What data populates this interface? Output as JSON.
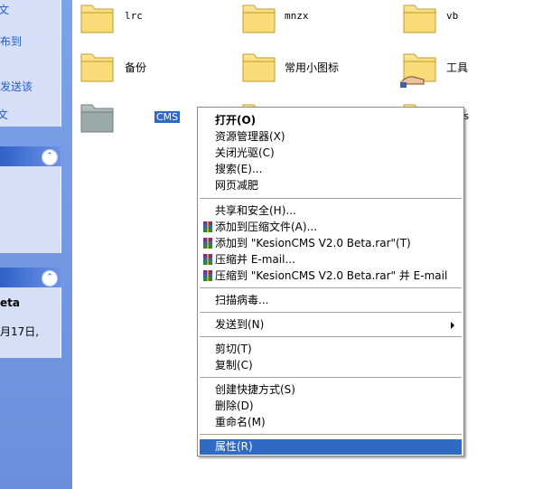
{
  "left_pane": {
    "section1_lines": [
      "布到",
      "发送该"
    ],
    "section2_heading": "",
    "section3_lines": [
      "eta",
      "月17日,"
    ]
  },
  "folders": [
    {
      "name": "lrc"
    },
    {
      "name": "mnzx"
    },
    {
      "name": "vb"
    },
    {
      "name": "备份"
    },
    {
      "name": "常用小图标"
    },
    {
      "name": "工具"
    },
    {
      "name": "CMS"
    },
    {
      "name": "s"
    }
  ],
  "context_menu": {
    "items": [
      {
        "label": "打开(O)",
        "bold": true
      },
      {
        "label": "资源管理器(X)"
      },
      {
        "label": "关闭光驱(C)"
      },
      {
        "label": "搜索(E)..."
      },
      {
        "label": "网页减肥"
      },
      {
        "label": "共享和安全(H)..."
      },
      {
        "label": "添加到压缩文件(A)...",
        "icon": "winrar-icon"
      },
      {
        "label": "添加到 \"KesionCMS V2.0 Beta.rar\"(T)",
        "icon": "winrar-icon"
      },
      {
        "label": "压缩并 E-mail...",
        "icon": "winrar-icon"
      },
      {
        "label": "压缩到 \"KesionCMS V2.0 Beta.rar\" 并 E-mail",
        "icon": "winrar-icon"
      },
      {
        "label": "扫描病毒..."
      },
      {
        "label": "发送到(N)"
      },
      {
        "label": "剪切(T)"
      },
      {
        "label": "复制(C)"
      },
      {
        "label": "创建快捷方式(S)"
      },
      {
        "label": "删除(D)"
      },
      {
        "label": "重命名(M)"
      },
      {
        "label": "属性(R)",
        "selected": true
      }
    ]
  },
  "colors": {
    "pane_blue": "#6a8fdd",
    "selection": "#316ac5",
    "folder_yellow": "#f5d76e"
  }
}
